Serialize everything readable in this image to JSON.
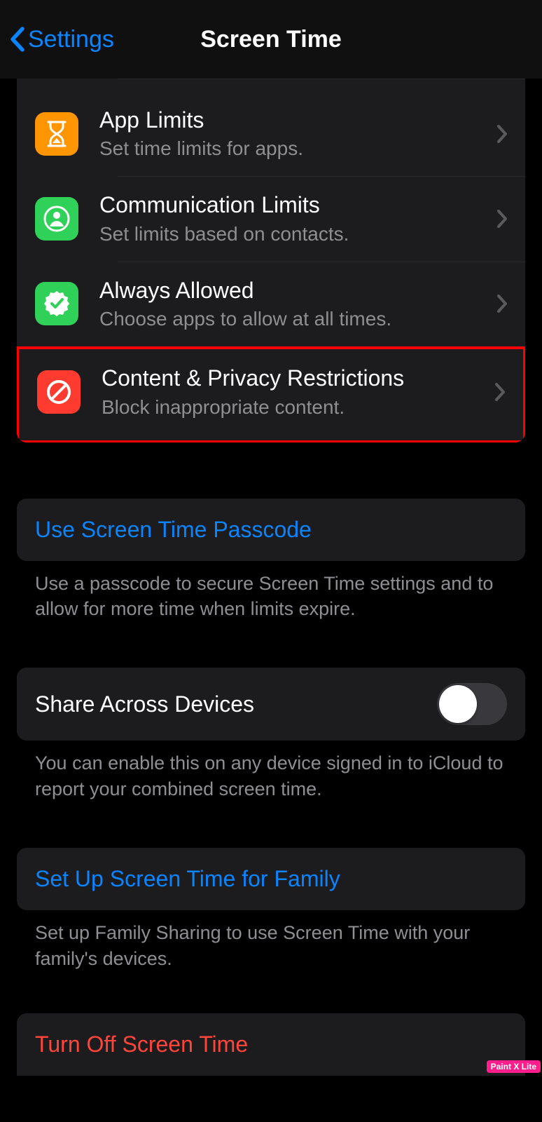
{
  "nav": {
    "back_label": "Settings",
    "title": "Screen Time"
  },
  "list": [
    {
      "title": "App Limits",
      "subtitle": "Set time limits for apps."
    },
    {
      "title": "Communication Limits",
      "subtitle": "Set limits based on contacts."
    },
    {
      "title": "Always Allowed",
      "subtitle": "Choose apps to allow at all times."
    },
    {
      "title": "Content & Privacy Restrictions",
      "subtitle": "Block inappropriate content."
    }
  ],
  "passcode": {
    "link": "Use Screen Time Passcode",
    "footer": "Use a passcode to secure Screen Time settings and to allow for more time when limits expire."
  },
  "share": {
    "label": "Share Across Devices",
    "footer": "You can enable this on any device signed in to iCloud to report your combined screen time."
  },
  "family": {
    "link": "Set Up Screen Time for Family",
    "footer": "Set up Family Sharing to use Screen Time with your family's devices."
  },
  "turn_off": {
    "label": "Turn Off Screen Time"
  },
  "watermark": "Paint X Lite"
}
